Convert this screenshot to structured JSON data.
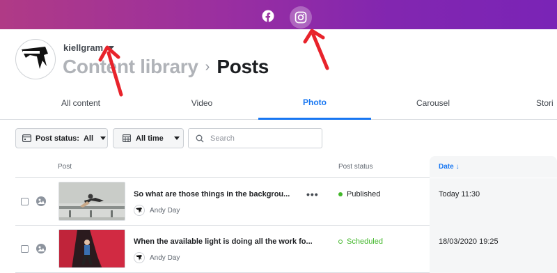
{
  "topbar": {
    "icons": [
      {
        "name": "facebook-icon"
      },
      {
        "name": "instagram-icon",
        "selected": true
      }
    ],
    "gradient": [
      "#b03a86",
      "#7a24b6"
    ]
  },
  "account": {
    "name": "kiellgram"
  },
  "breadcrumb": {
    "library": "Content library",
    "separator": "›",
    "current": "Posts"
  },
  "tabs": [
    {
      "label": "All content"
    },
    {
      "label": "Video"
    },
    {
      "label": "Photo",
      "active": true
    },
    {
      "label": "Carousel"
    },
    {
      "label": "Stori"
    }
  ],
  "filters": {
    "post_status_label": "Post status:",
    "post_status_value": "All",
    "time_label": "All time",
    "search_placeholder": "Search"
  },
  "table": {
    "headers": {
      "post": "Post",
      "status": "Post status",
      "date": "Date ↓"
    },
    "rows": [
      {
        "title": "So what are those things in the backgrou...",
        "author": "Andy Day",
        "status": "Published",
        "date": "Today 11:30",
        "more": "•••"
      },
      {
        "title": "When the available light is doing all the work fo...",
        "author": "Andy Day",
        "status": "Scheduled",
        "date": "18/03/2020 19:25"
      }
    ]
  },
  "colors": {
    "accent": "#1877f2",
    "status_green": "#42b72a",
    "annotation_red": "#e8232b"
  }
}
